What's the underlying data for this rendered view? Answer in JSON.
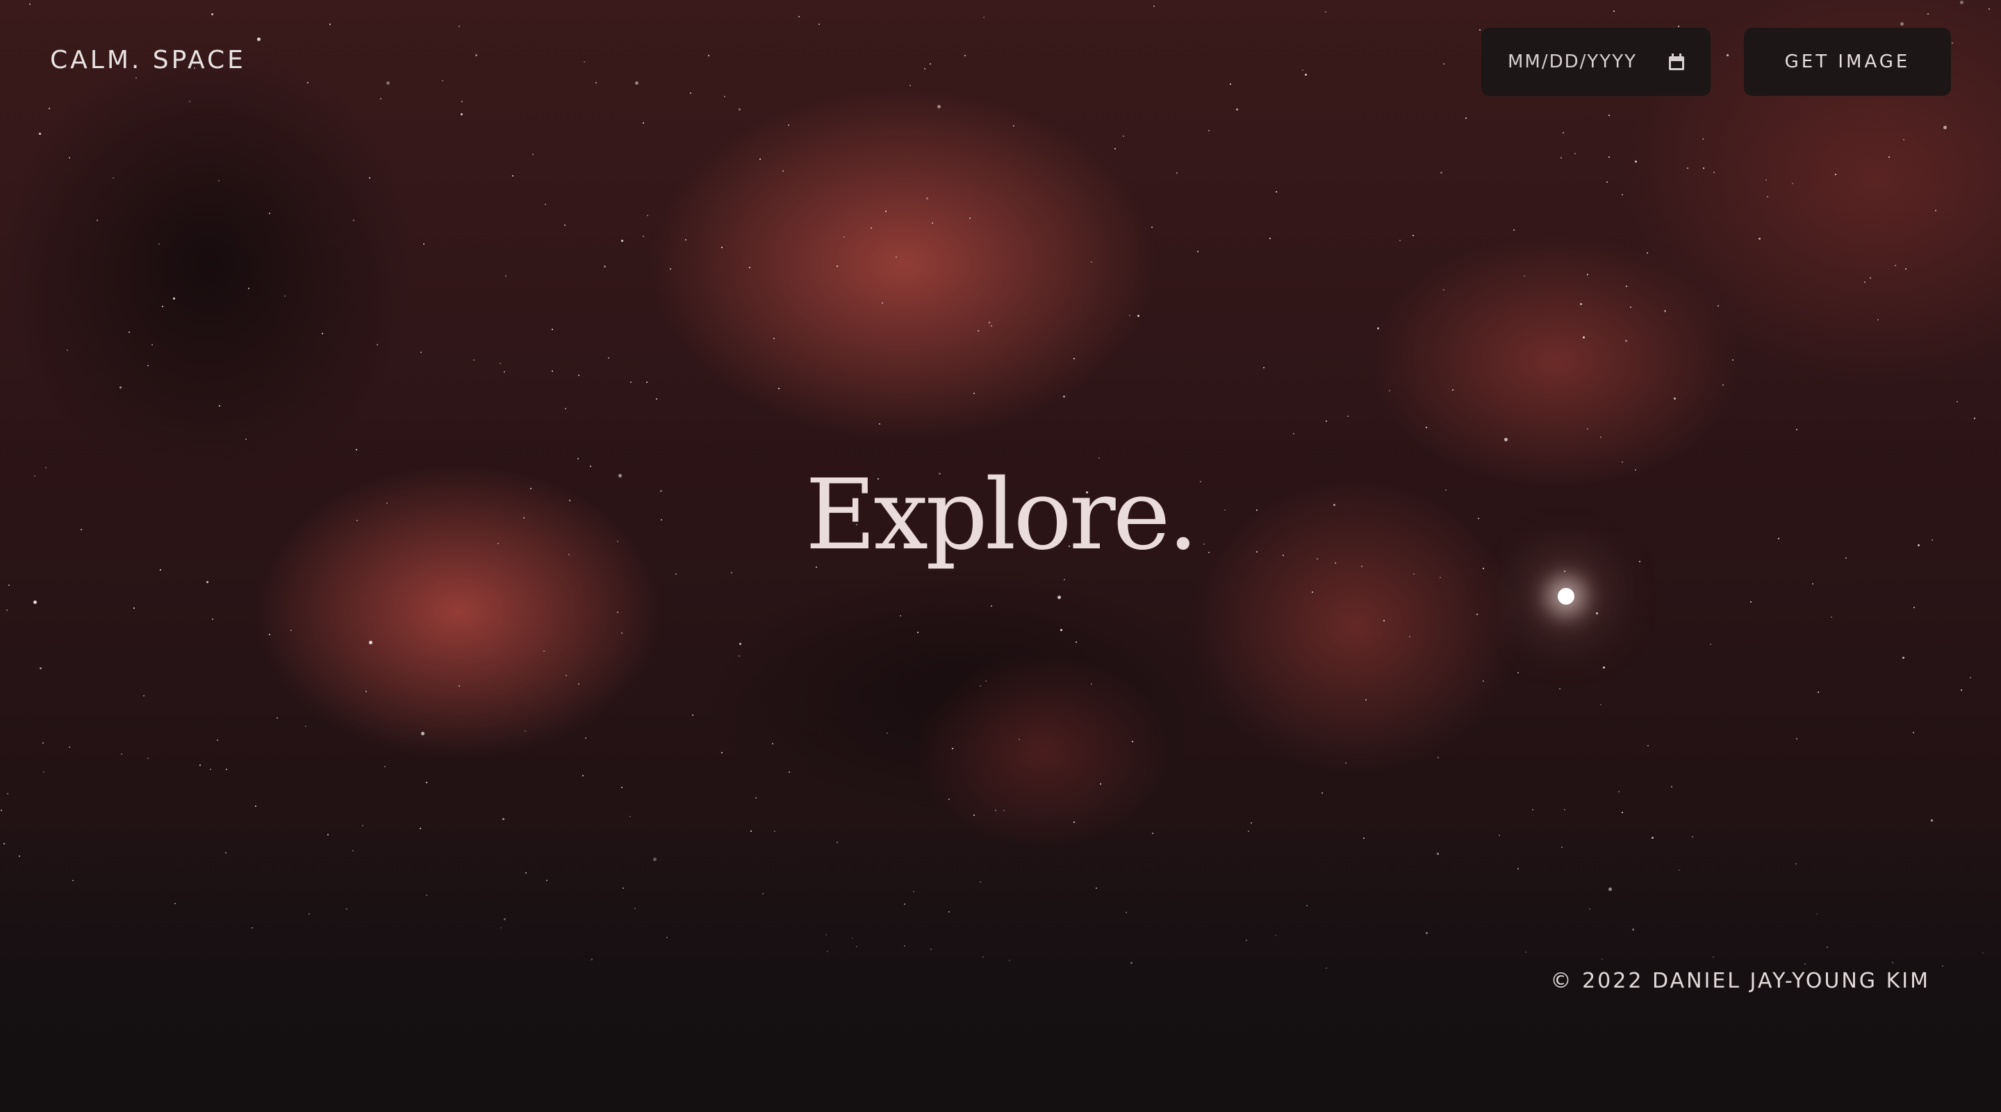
{
  "header": {
    "logo": "CALM. SPACE",
    "date_input": {
      "placeholder": "MM/DD/YYYY",
      "icon": "calendar-icon"
    },
    "get_image_label": "GET IMAGE"
  },
  "hero": {
    "title": "Explore."
  },
  "footer": {
    "copyright": "© 2022 DANIEL JAY-YOUNG KIM"
  },
  "colors": {
    "background": "#141012",
    "nebula": "#a8463e",
    "control_bg": "#1c1616",
    "text": "#eadcdc"
  }
}
